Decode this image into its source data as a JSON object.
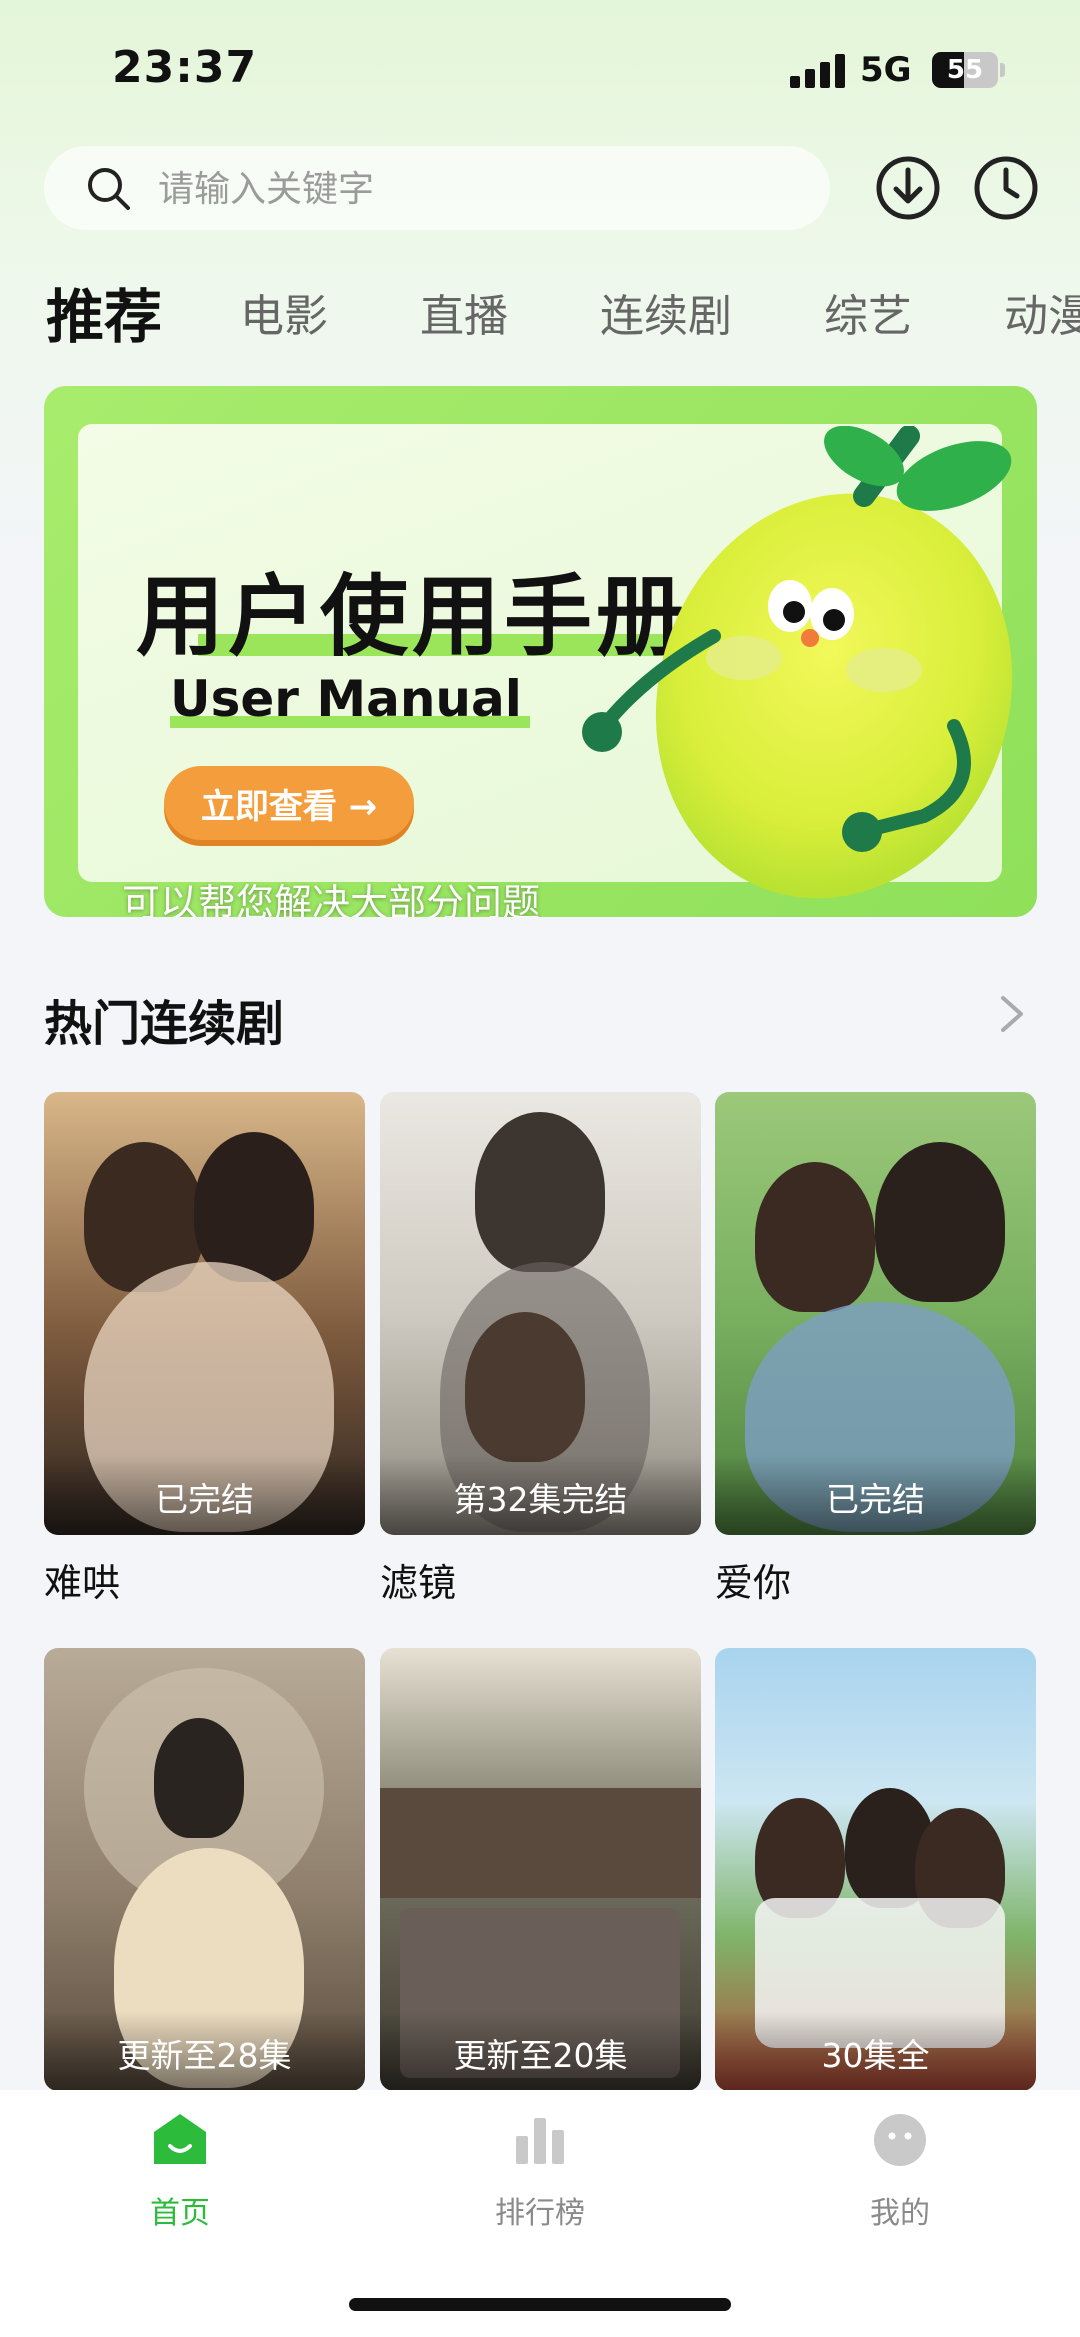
{
  "status_bar": {
    "time": "23:37",
    "network": "5G",
    "battery": "55"
  },
  "search": {
    "placeholder": "请输入关键字"
  },
  "tabs": [
    {
      "label": "推荐",
      "active": true
    },
    {
      "label": "电影"
    },
    {
      "label": "直播"
    },
    {
      "label": "连续剧"
    },
    {
      "label": "综艺"
    },
    {
      "label": "动漫"
    }
  ],
  "banner": {
    "title": "用户使用手册",
    "subtitle": "User Manual",
    "button": "立即查看 →",
    "caption": "可以帮您解决大部分问题"
  },
  "section": {
    "title": "热门连续剧",
    "items": [
      {
        "title": "难哄",
        "status": "已完结"
      },
      {
        "title": "滤镜",
        "status": "第32集完结"
      },
      {
        "title": "爱你",
        "status": "已完结"
      },
      {
        "title": "",
        "status": "更新至28集"
      },
      {
        "title": "",
        "status": "更新至20集"
      },
      {
        "title": "",
        "status": "30集全"
      }
    ]
  },
  "bottom_nav": [
    {
      "label": "首页",
      "icon": "home-icon",
      "active": true
    },
    {
      "label": "排行榜",
      "icon": "ranking-icon"
    },
    {
      "label": "我的",
      "icon": "profile-icon"
    }
  ],
  "colors": {
    "accent": "#2dbb3c",
    "banner_green": "#9be55b",
    "button_orange": "#f49d3c"
  }
}
